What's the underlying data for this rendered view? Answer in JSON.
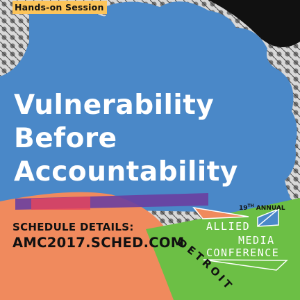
{
  "badge": "Hands-on Session",
  "title": [
    "Vulnerability",
    "Before",
    "Accountability"
  ],
  "schedule": {
    "label": "SCHEDULE DETAILS:",
    "url": "AMC2017.SCHED.COM"
  },
  "logo": {
    "edition": "19",
    "edition_suffix": "TH",
    "annual": "ANNUAL",
    "line1": "ALLIED",
    "line2": "MEDIA",
    "line3": "CONFERENCE"
  },
  "city": "DETROIT",
  "colors": {
    "blue": "#4a88c8",
    "orange": "#f08a5d",
    "green": "#6cbf45",
    "yellow": "#fcc45a",
    "purple": "#6a3fa0"
  }
}
